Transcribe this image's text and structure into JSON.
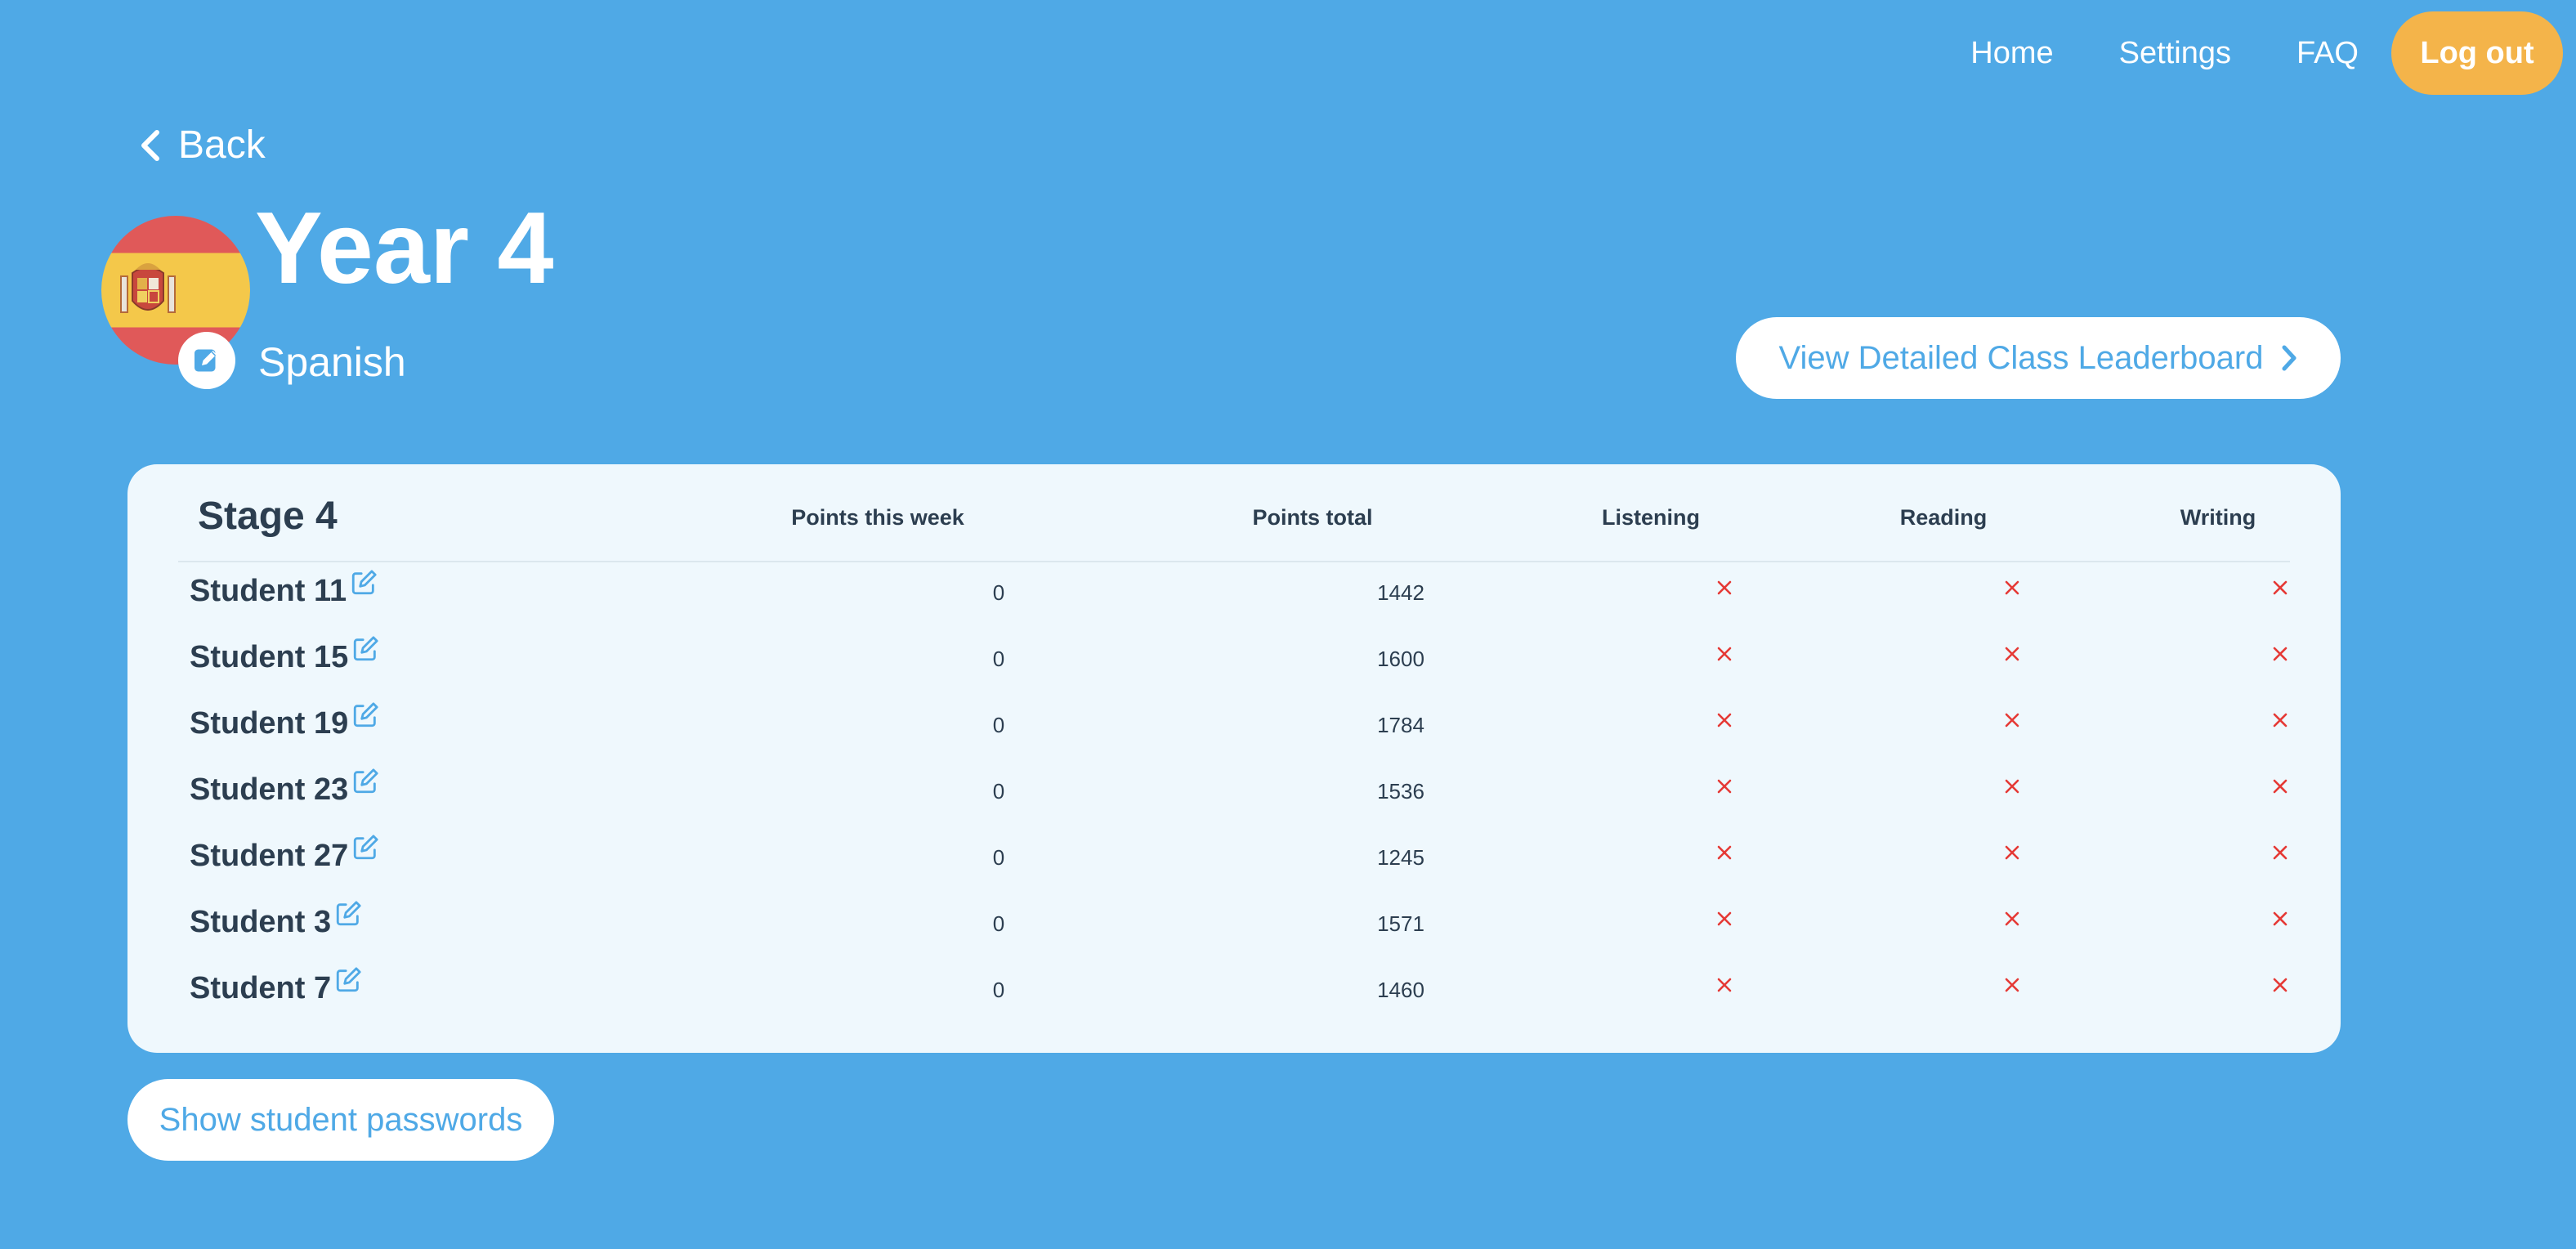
{
  "nav": {
    "home": "Home",
    "settings": "Settings",
    "faq": "FAQ",
    "logout": "Log out"
  },
  "back_label": "Back",
  "class": {
    "title": "Year 4",
    "language": "Spanish",
    "flag_icon": "spain-flag-icon"
  },
  "leaderboard_button": "View Detailed Class Leaderboard",
  "table": {
    "stage": "Stage 4",
    "columns": [
      "Points this week",
      "Points total",
      "Listening",
      "Reading",
      "Writing"
    ],
    "rows": [
      {
        "name": "Student 11",
        "points_week": "0",
        "points_total": "1442",
        "listening": "×",
        "reading": "×",
        "writing": "×"
      },
      {
        "name": "Student 15",
        "points_week": "0",
        "points_total": "1600",
        "listening": "×",
        "reading": "×",
        "writing": "×"
      },
      {
        "name": "Student 19",
        "points_week": "0",
        "points_total": "1784",
        "listening": "×",
        "reading": "×",
        "writing": "×"
      },
      {
        "name": "Student 23",
        "points_week": "0",
        "points_total": "1536",
        "listening": "×",
        "reading": "×",
        "writing": "×"
      },
      {
        "name": "Student 27",
        "points_week": "0",
        "points_total": "1245",
        "listening": "×",
        "reading": "×",
        "writing": "×"
      },
      {
        "name": "Student 3",
        "points_week": "0",
        "points_total": "1571",
        "listening": "×",
        "reading": "×",
        "writing": "×"
      },
      {
        "name": "Student 7",
        "points_week": "0",
        "points_total": "1460",
        "listening": "×",
        "reading": "×",
        "writing": "×"
      }
    ]
  },
  "show_passwords_button": "Show student passwords",
  "colors": {
    "background": "#4fa9e6",
    "accent": "#f4b44a",
    "cross": "#e53935",
    "text_dark": "#2c3e50"
  }
}
